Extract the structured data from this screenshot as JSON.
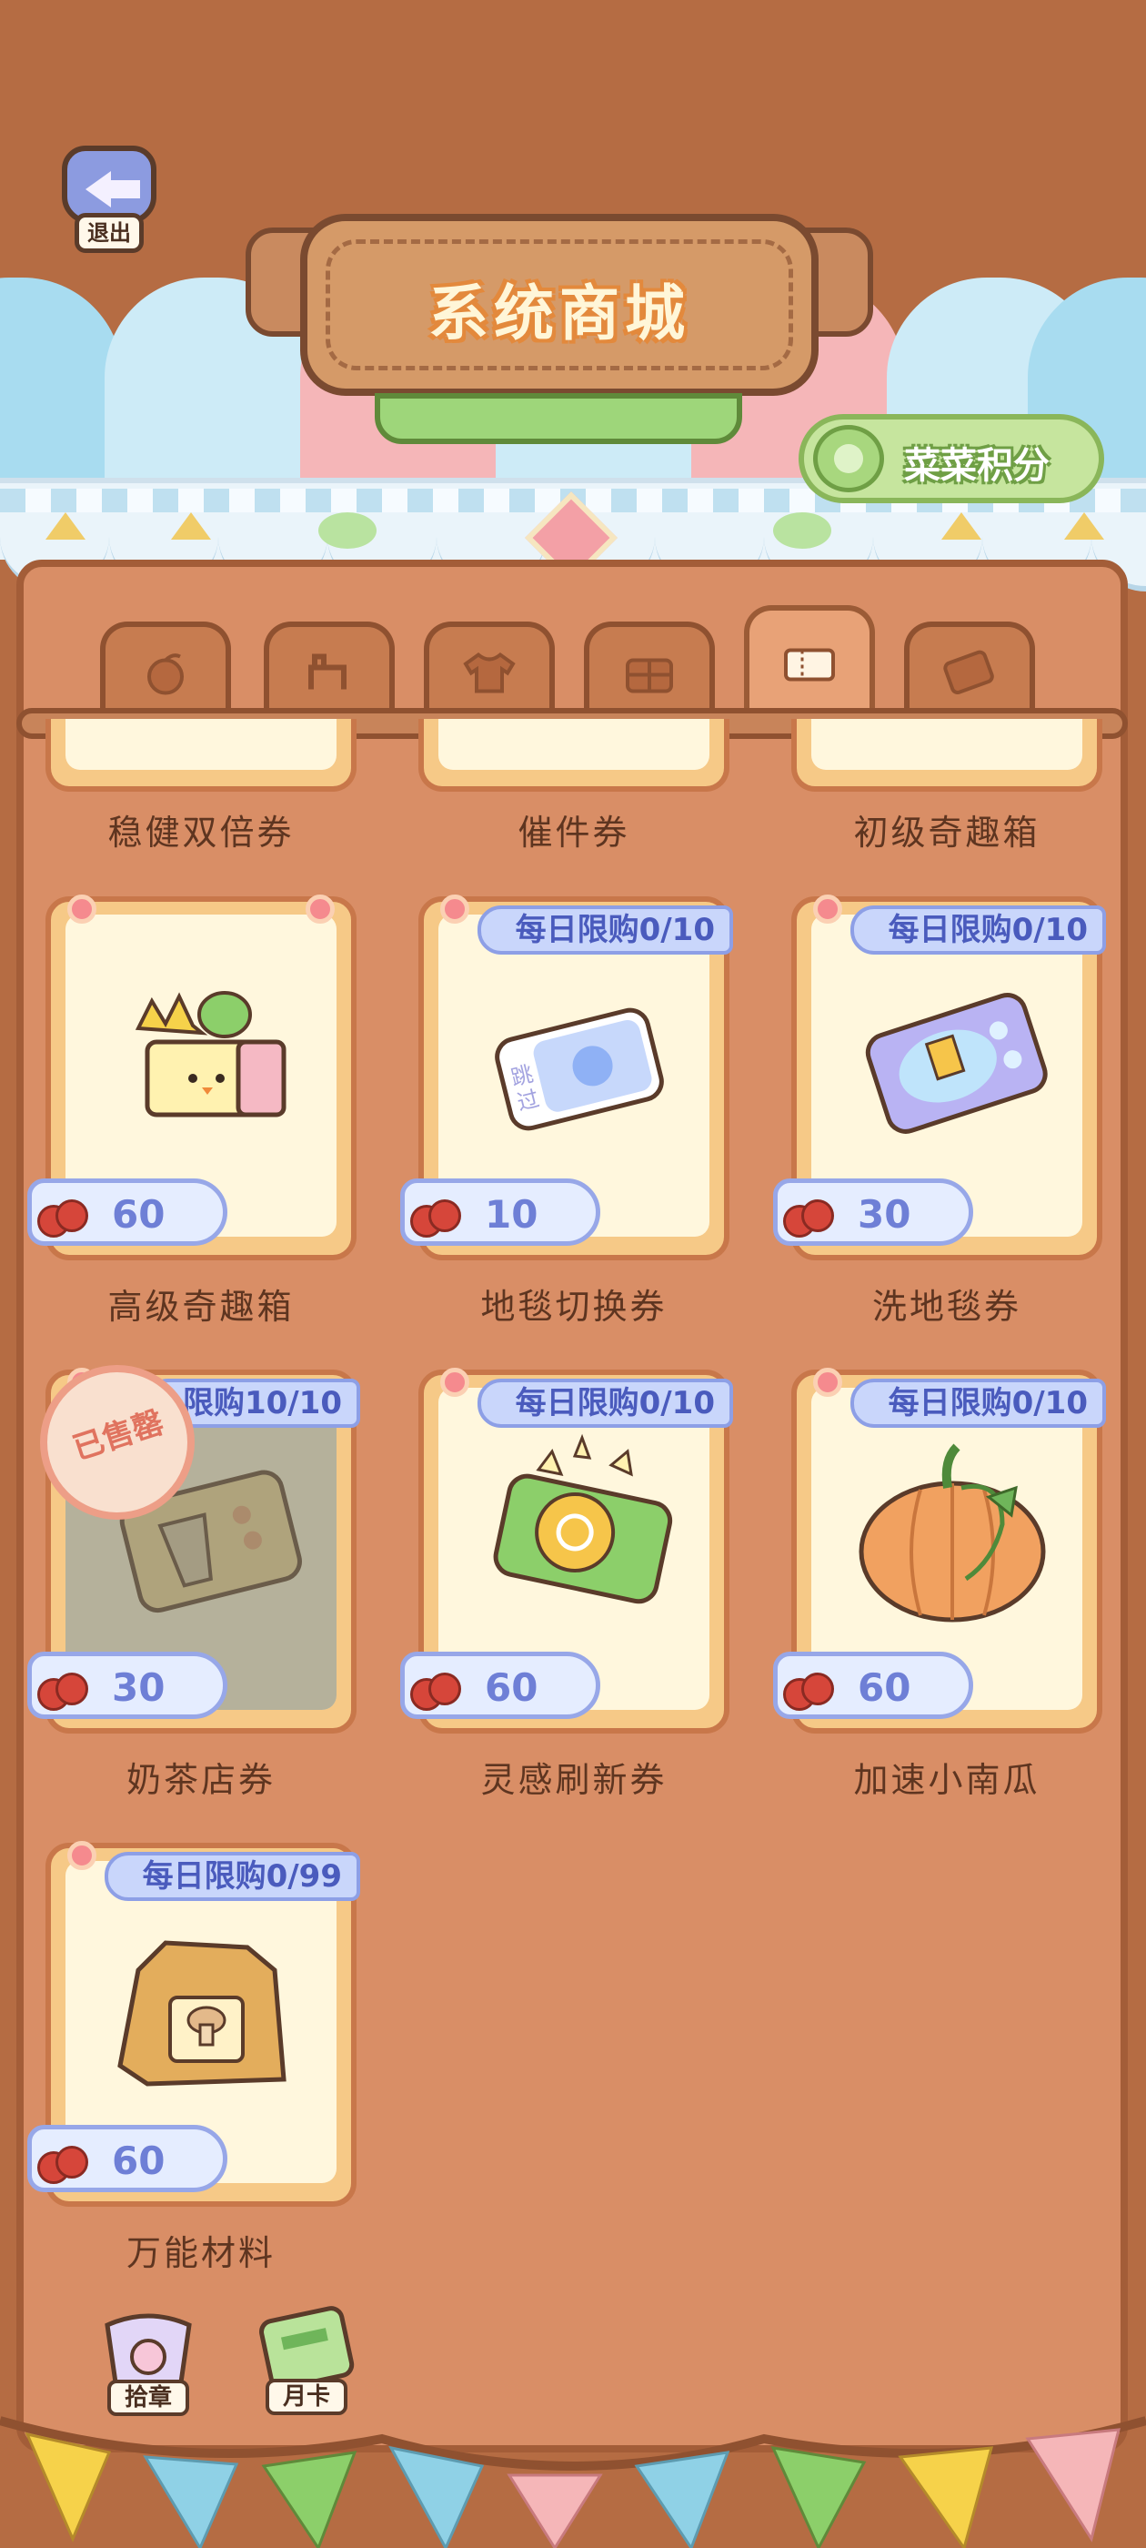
{
  "exit_label": "退出",
  "title": "系统商城",
  "points_label": "菜菜积分",
  "tabs": [
    {
      "icon": "fruit-icon",
      "active": false
    },
    {
      "icon": "animal-icon",
      "active": false
    },
    {
      "icon": "shirt-icon",
      "active": false
    },
    {
      "icon": "gift-icon",
      "active": false
    },
    {
      "icon": "ticket-icon",
      "active": true
    },
    {
      "icon": "card-icon",
      "active": false
    }
  ],
  "partial_items": [
    {
      "name": "稳健双倍券"
    },
    {
      "name": "催件券"
    },
    {
      "name": "初级奇趣箱"
    }
  ],
  "items": [
    {
      "name": "高级奇趣箱",
      "price": "60",
      "limit": "",
      "sold": false,
      "icon": "fun-box-icon"
    },
    {
      "name": "地毯切换券",
      "price": "10",
      "limit": "每日限购0/10",
      "sold": false,
      "icon": "carpet-ticket-icon"
    },
    {
      "name": "洗地毯券",
      "price": "30",
      "limit": "每日限购0/10",
      "sold": false,
      "icon": "wash-ticket-icon"
    },
    {
      "name": "奶茶店券",
      "price": "30",
      "limit": "限购10/10",
      "sold": true,
      "sold_label": "已售罄",
      "icon": "milk-tea-ticket-icon"
    },
    {
      "name": "灵感刷新券",
      "price": "60",
      "limit": "每日限购0/10",
      "sold": false,
      "icon": "inspiration-ticket-icon"
    },
    {
      "name": "加速小南瓜",
      "price": "60",
      "limit": "每日限购0/10",
      "sold": false,
      "icon": "pumpkin-icon"
    },
    {
      "name": "万能材料",
      "price": "60",
      "limit": "每日限购0/99",
      "sold": false,
      "icon": "material-bag-icon"
    }
  ],
  "bottom_buttons": [
    {
      "label": "拾章",
      "icon": "stamp-icon"
    },
    {
      "label": "月卡",
      "icon": "month-card-icon"
    }
  ]
}
